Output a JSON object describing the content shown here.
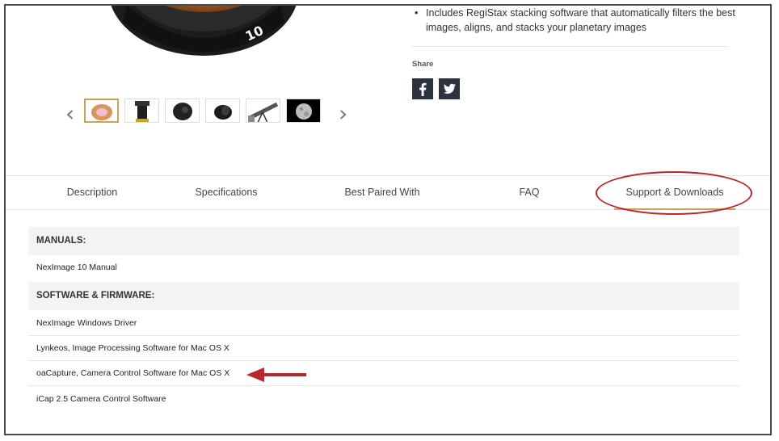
{
  "top": {
    "feature_bullet": "Includes RegiStax stacking software that automatically filters the best images, aligns, and stacks your planetary images",
    "share_label": "Share",
    "product_lens_marking": "10",
    "social": [
      {
        "icon": "facebook-icon",
        "glyph": "f"
      },
      {
        "icon": "twitter-icon",
        "glyph": "t"
      }
    ],
    "thumbnail_prev_glyph": "‹",
    "thumbnail_next_glyph": "›",
    "thumbnails_count": 6
  },
  "tabs": [
    {
      "label": "Description"
    },
    {
      "label": "Specifications"
    },
    {
      "label": "Best Paired With"
    },
    {
      "label": "FAQ"
    },
    {
      "label": "Support & Downloads"
    }
  ],
  "downloads": {
    "manuals_header": "MANUALS:",
    "manuals": [
      "NexImage 10 Manual"
    ],
    "software_header": "SOFTWARE & FIRMWARE:",
    "software": [
      "NexImage Windows Driver",
      "Lynkeos, Image Processing Software for Mac OS X",
      "oaCapture, Camera Control Software for Mac OS X",
      "iCap 2.5 Camera Control Software"
    ]
  },
  "colors": {
    "annotation": "#b7282e",
    "tab_underline": "#c9a25a",
    "section_header_bg": "#f2f3f5",
    "social_bg": "#2b3340"
  }
}
